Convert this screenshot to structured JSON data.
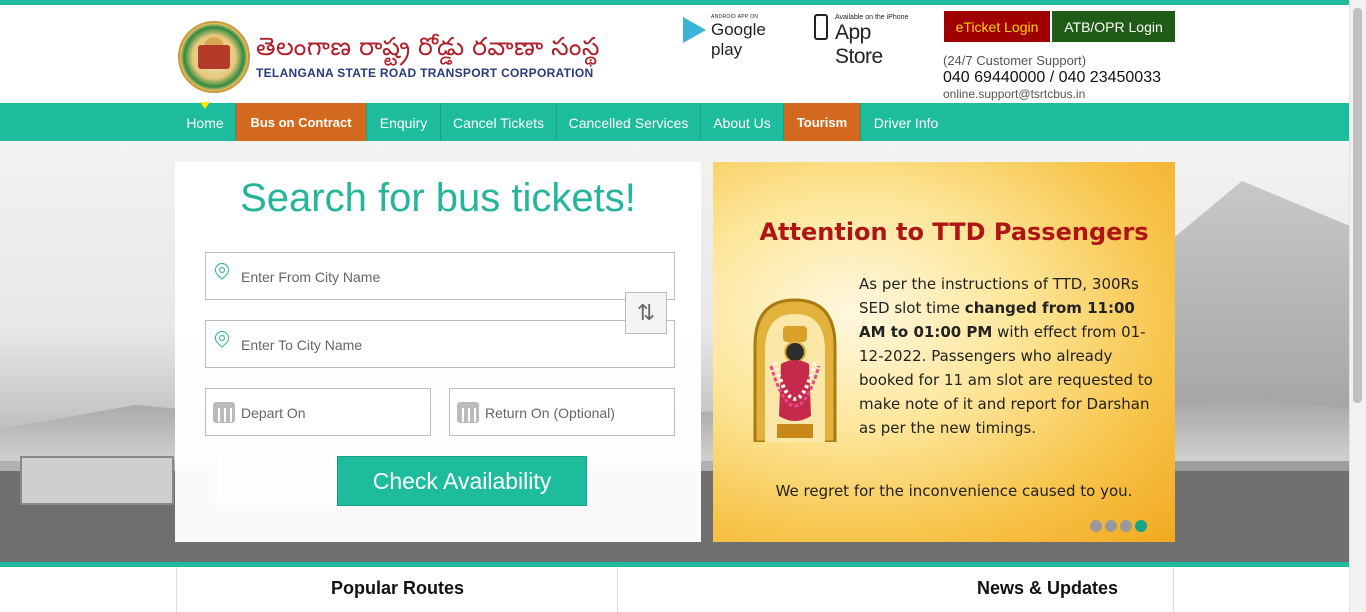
{
  "header": {
    "org_telugu": "తెలంగాణ  రాష్ట్ర రోడ్డు రవాణా సంస్థ",
    "org_english": "TELANGANA STATE ROAD TRANSPORT CORPORATION",
    "google_small": "ANDROID APP ON",
    "google_big": "Google play",
    "apple_small": "Available on the iPhone",
    "apple_big": "App Store",
    "eticket_login": "eTicket Login",
    "atb_login": "ATB/OPR Login",
    "support_label": "(24/7 Customer Support)",
    "support_phones": "040 69440000 / 040 23450033",
    "support_email": "online.support@tsrtcbus.in"
  },
  "nav": {
    "items": [
      {
        "label": "Home"
      },
      {
        "label": "Bus on Contract"
      },
      {
        "label": "Enquiry"
      },
      {
        "label": "Cancel Tickets"
      },
      {
        "label": "Cancelled Services"
      },
      {
        "label": "About Us"
      },
      {
        "label": "Tourism"
      },
      {
        "label": "Driver Info"
      }
    ]
  },
  "search": {
    "title": "Search for bus tickets!",
    "from_placeholder": "Enter From City Name",
    "to_placeholder": "Enter To City Name",
    "depart_placeholder": "Depart On",
    "return_placeholder": "Return On (Optional)",
    "swap_glyph": "⇅",
    "check_button": "Check Availability"
  },
  "notice": {
    "title": "Attention to TTD Passengers",
    "body_part1": "As per the instructions of TTD, 300Rs SED slot time ",
    "body_bold": "changed from 11:00 AM to 01:00 PM",
    "body_part2": " with effect from 01-12-2022. Passengers who already booked for 11 am slot are requested to make note of it and report for Darshan as per the new timings.",
    "regret": "We regret for the inconvenience caused to you.",
    "slide_count": 4,
    "active_slide": 4
  },
  "panels": {
    "popular_routes": "Popular Routes",
    "news_updates": "News & Updates"
  },
  "colors": {
    "brand_teal": "#1cbc9c",
    "orange_tab": "#d2691e",
    "eticket_bg": "#a00000",
    "atb_bg": "#1f5c17",
    "notice_title": "#b01515"
  }
}
